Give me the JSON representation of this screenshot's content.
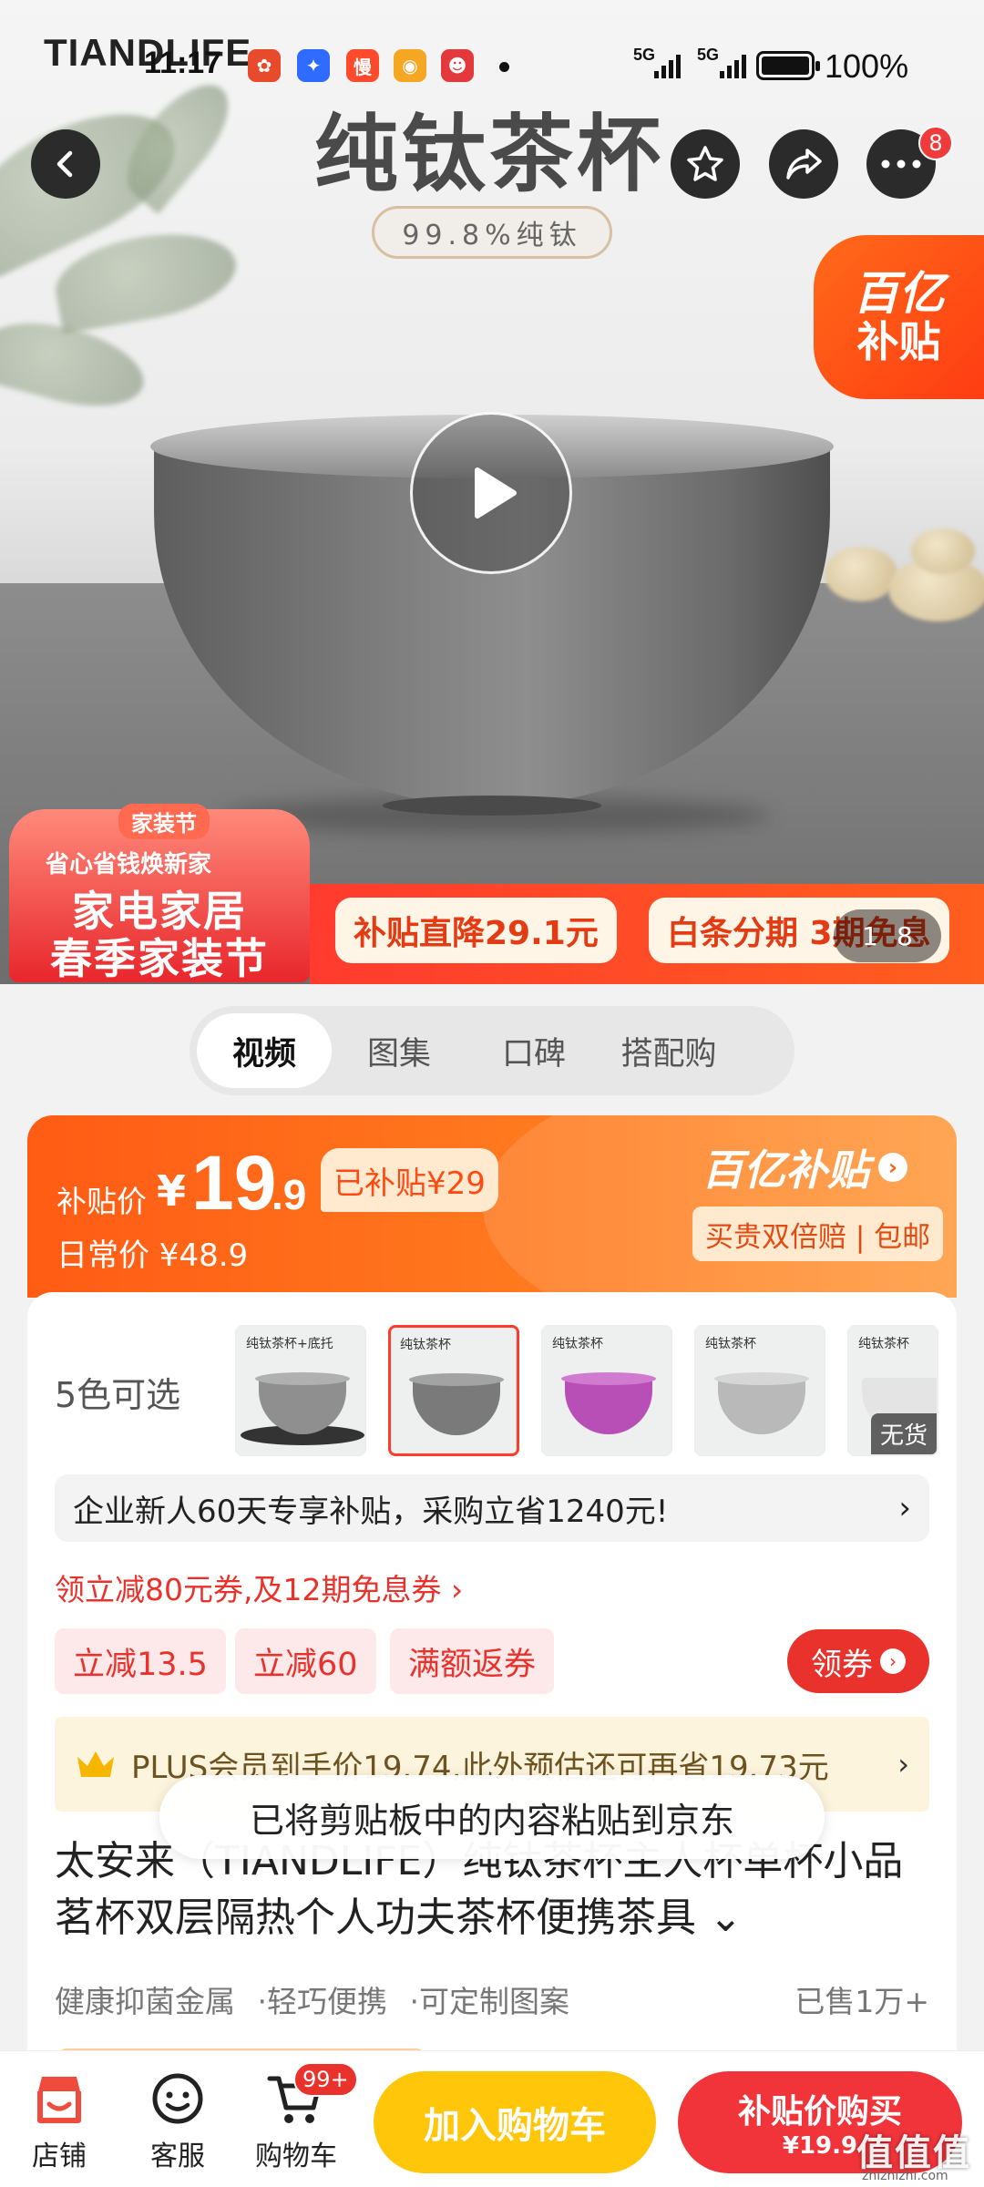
{
  "status_bar": {
    "time": "11:17",
    "network_1": "5G",
    "network_2": "5G",
    "battery": "100%"
  },
  "hero": {
    "brand": "TIANDLIFE",
    "title": "纯钛茶杯",
    "purity": "99.8%纯钛",
    "subsidy_corner_line1": "百亿",
    "subsidy_corner_line2": "补贴",
    "cart_badge": "8",
    "promo": {
      "tag": "家装节",
      "sub": "省心省钱焕新家",
      "line1": "家电家居",
      "line2": "春季家装节",
      "pill1": "补贴直降29.1元",
      "pill2": "白条分期 3期免息"
    },
    "gallery_current": "1",
    "gallery_total": "8"
  },
  "tabs": [
    "视频",
    "图集",
    "口碑",
    "搭配购"
  ],
  "price": {
    "label": "补贴价",
    "currency": "¥",
    "integer": "19",
    "decimal": ".9",
    "subsidy_tag": "已补贴¥29",
    "regular": "日常价 ¥48.9",
    "brand_subsidy": "百亿补贴",
    "guarantee": "买贵双倍赔 | 包邮"
  },
  "variants": {
    "label": "5色可选",
    "items": [
      {
        "head": "纯钛茶杯+底托",
        "color": "#8f8f8f"
      },
      {
        "head": "纯钛茶杯",
        "color": "#7a7a7a"
      },
      {
        "head": "纯钛茶杯",
        "color": "#b84fb6"
      },
      {
        "head": "纯钛茶杯",
        "color": "#b9b9b9"
      },
      {
        "head": "纯钛茶杯",
        "color": "#e4e4e4",
        "soldout": "无货"
      }
    ]
  },
  "enterprise": {
    "text": "企业新人60天专享补贴，采购立省1240元!",
    "arrow": "›"
  },
  "coupon_line": "领立减80元券,及12期免息券 ›",
  "chips": [
    "立减13.5",
    "立减60",
    "满额返券"
  ],
  "get_coupon": "领券",
  "plus": {
    "text": "PLUS会员到手价19.74,此外预估还可再省19.73元",
    "arrow": "›"
  },
  "toast": "已将剪贴板中的内容粘贴到京东",
  "product_name": "太安来（TIANDLIFE）纯钛茶杯主人杯单杯小品茗杯双层隔热个人功夫茶杯便携茶具 ⌄",
  "features": [
    "健康抑菌金属",
    "·轻巧便携",
    "·可定制图案"
  ],
  "sold": "已售1万+",
  "bottom_bar": {
    "shop": "店铺",
    "service": "客服",
    "cart": "购物车",
    "cart_badge": "99+",
    "add_cart": "加入购物车",
    "buy_line1": "补贴价购买",
    "buy_line2": "¥19.9"
  },
  "watermark": "值值值",
  "watermark_url": "zhizhizhi.com"
}
